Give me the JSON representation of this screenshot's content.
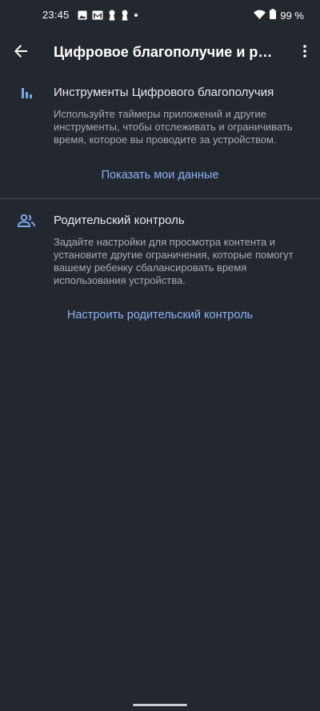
{
  "status_bar": {
    "time": "23:45",
    "battery_text": "99 %",
    "notification_icons": [
      "image-icon",
      "gmail-icon",
      "keyhole-icon",
      "keyhole-icon",
      "dot-icon"
    ]
  },
  "app_bar": {
    "title": "Цифровое благополучие и родительский контроль"
  },
  "sections": [
    {
      "icon": "bar-chart-icon",
      "title": "Инструменты Цифрового благополучия",
      "description": "Используйте таймеры приложений и другие инструменты, чтобы отслеживать и ограничивать время, которое вы проводите за устройством.",
      "action": "Показать мои данные"
    },
    {
      "icon": "people-icon",
      "title": "Родительский контроль",
      "description": "Задайте настройки для просмотра контента и установите другие ограничения, которые помогут вашему ребенку сбалансировать время использования устройства.",
      "action": "Настроить родительский контроль"
    }
  ],
  "colors": {
    "background": "#23272e",
    "accent": "#8ab4f8",
    "icon_blue": "#7aa7e8",
    "secondary_text": "#a7adb4"
  }
}
